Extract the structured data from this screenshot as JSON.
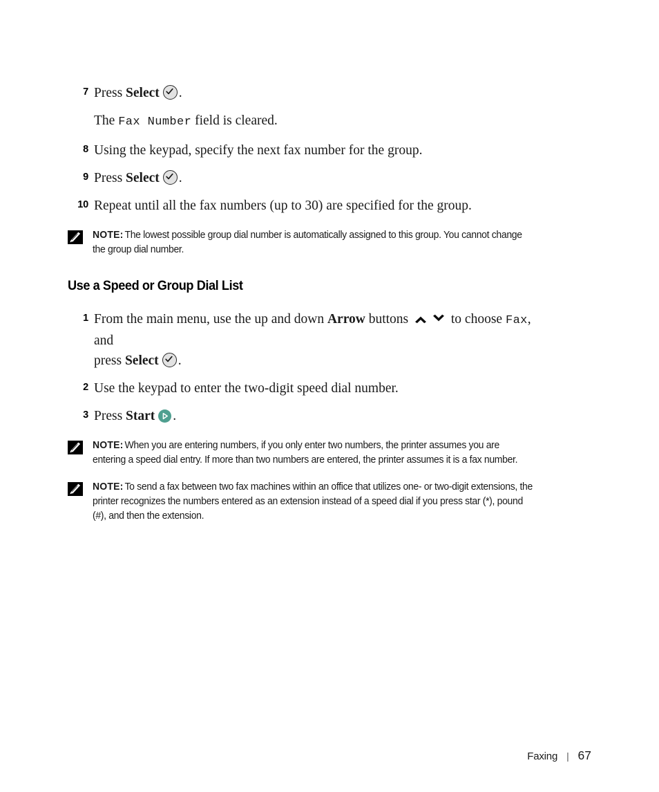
{
  "page": {
    "footer": {
      "section_label": "Faxing",
      "separator": "|",
      "page_number": "67"
    }
  },
  "steps_continued": [
    {
      "number": "7",
      "text_before": "Press ",
      "bold_term": "Select",
      "icon": "select-check-icon",
      "text_after": "."
    },
    {
      "number": "",
      "sub_paragraph": {
        "text_before": "The ",
        "mono_term": "Fax Number",
        "text_after": " field is cleared."
      }
    },
    {
      "number": "8",
      "text_before": "Using the keypad, specify the next fax number for the group.",
      "bold_term": "",
      "icon": "",
      "text_after": ""
    },
    {
      "number": "9",
      "text_before": "Press ",
      "bold_term": "Select",
      "icon": "select-check-icon",
      "text_after": "."
    },
    {
      "number": "10",
      "text_before": "Repeat until all the fax numbers (up to 30) are specified for the group.",
      "bold_term": "",
      "icon": "",
      "text_after": ""
    }
  ],
  "note_1": {
    "label": "NOTE:",
    "icon": "note-pencil-icon",
    "text": "The lowest possible group dial number is automatically assigned to this group. You cannot change the group dial number."
  },
  "section": {
    "heading": "Use a Speed or Group Dial List"
  },
  "section_steps": {
    "step1": {
      "number": "1",
      "part1": "From the main menu, use the up and down ",
      "bold1": "Arrow",
      "part2": " buttons ",
      "icon_up": "arrow-up-icon",
      "icon_down": "arrow-down-icon",
      "part3": " to choose ",
      "mono1": "Fax",
      "part4": ", and",
      "line2_part1": "press ",
      "line2_bold": "Select",
      "line2_icon": "select-check-icon",
      "line2_part2": "."
    },
    "step2": {
      "number": "2",
      "text": "Use the keypad to enter the two-digit speed dial number."
    },
    "step3": {
      "number": "3",
      "text_before": "Press ",
      "bold_term": "Start",
      "icon": "start-play-icon",
      "text_after": "."
    }
  },
  "note_2": {
    "label": "NOTE:",
    "icon": "note-pencil-icon",
    "text": "When you are entering numbers, if you only enter two numbers, the printer assumes you are entering a speed dial entry. If more than two numbers are entered, the printer assumes it is a fax number."
  },
  "note_3": {
    "label": "NOTE:",
    "icon": "note-pencil-icon",
    "text": "To send a fax between two fax machines within an office that utilizes one- or two-digit extensions, the printer recognizes the numbers entered as an extension instead of a speed dial if you press star (*), pound (#), and then the extension."
  },
  "colors": {
    "start_button": "#4f9f90",
    "select_button": "#e2e2e2",
    "text": "#1a1a1a",
    "note_icon": "#000000"
  }
}
